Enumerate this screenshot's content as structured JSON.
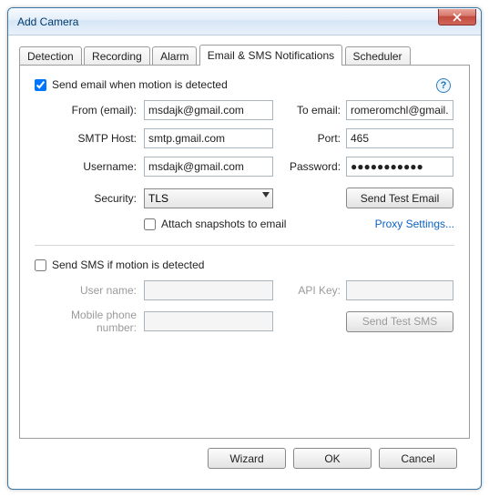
{
  "window": {
    "title": "Add Camera"
  },
  "tabs": {
    "detection": "Detection",
    "recording": "Recording",
    "alarm": "Alarm",
    "email_sms": "Email & SMS Notifications",
    "scheduler": "Scheduler",
    "active": "email_sms"
  },
  "email": {
    "enable_label": "Send email when motion is detected",
    "enable_checked": true,
    "from_label": "From (email):",
    "from_value": "msdajk@gmail.com",
    "to_label": "To email:",
    "to_value": "romeromchl@gmail.com",
    "smtp_label": "SMTP Host:",
    "smtp_value": "smtp.gmail.com",
    "port_label": "Port:",
    "port_value": "465",
    "user_label": "Username:",
    "user_value": "msdajk@gmail.com",
    "pass_label": "Password:",
    "pass_value": "●●●●●●●●●●●",
    "security_label": "Security:",
    "security_value": "TLS",
    "send_test_label": "Send Test Email",
    "attach_label": "Attach snapshots to email",
    "attach_checked": false,
    "proxy_link": "Proxy Settings..."
  },
  "sms": {
    "enable_label": "Send SMS if motion is detected",
    "enable_checked": false,
    "user_label": "User name:",
    "user_value": "",
    "api_label": "API Key:",
    "api_value": "",
    "phone_label": "Mobile phone number:",
    "phone_value": "",
    "send_test_label": "Send Test SMS"
  },
  "footer": {
    "wizard": "Wizard",
    "ok": "OK",
    "cancel": "Cancel"
  },
  "help_tooltip": "?"
}
